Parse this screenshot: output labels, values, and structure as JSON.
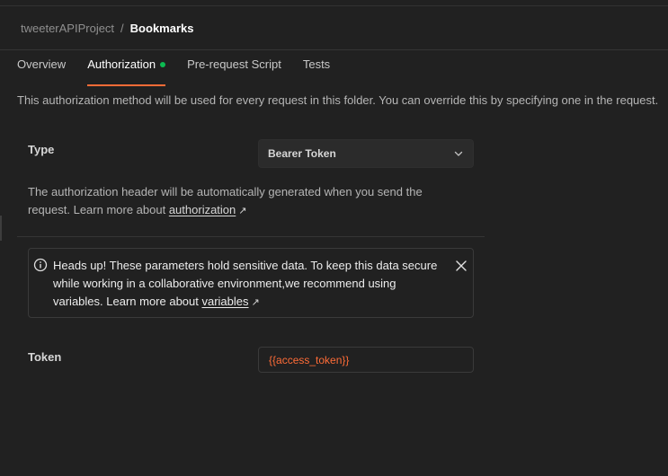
{
  "breadcrumb": {
    "parent": "tweeterAPIProject",
    "separator": "/",
    "current": "Bookmarks"
  },
  "tabs": [
    {
      "label": "Overview",
      "active": false
    },
    {
      "label": "Authorization",
      "active": true,
      "indicator_color": "#0cbb52"
    },
    {
      "label": "Pre-request Script",
      "active": false
    },
    {
      "label": "Tests",
      "active": false
    }
  ],
  "folder_note": "This authorization method will be used for every request in this folder. You can override this by specifying one in the request.",
  "auth_type": {
    "label": "Type",
    "selected": "Bearer Token",
    "icon": "chevron-down-icon"
  },
  "auth_help": {
    "text": "The authorization header will be automatically generated when you send the request. Learn more about ",
    "link": "authorization",
    "link_icon": "↗"
  },
  "warning": {
    "icon": "info-icon",
    "text": "Heads up! These parameters hold sensitive data. To keep this data secure while working in a collaborative environment,we recommend using variables. Learn more about ",
    "link": "variables",
    "link_icon": "↗",
    "close_icon": "close-icon"
  },
  "token": {
    "label": "Token",
    "value": "{{access_token}}",
    "value_color": "#ff6c37"
  },
  "colors": {
    "accent": "#ff6c37",
    "background": "#212121",
    "active_dot": "#0cbb52"
  }
}
